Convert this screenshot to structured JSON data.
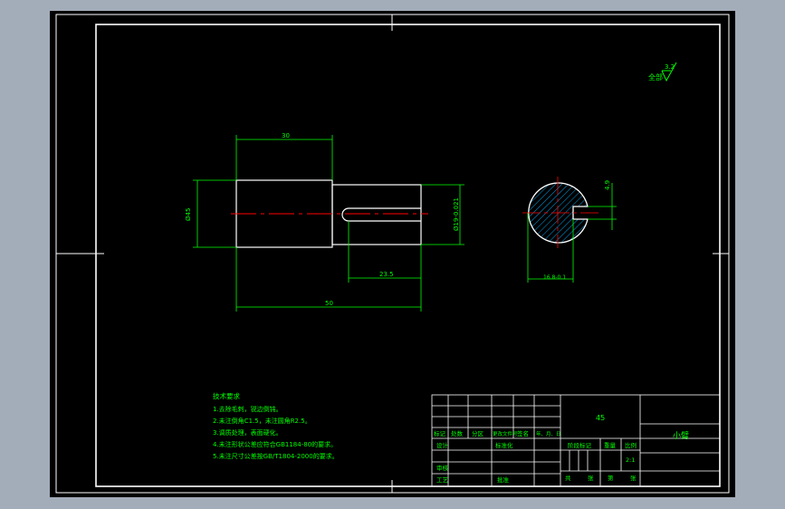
{
  "colors": {
    "background": "#000000",
    "frame": "#ffffff",
    "dimension": "#00ff00",
    "text": "#00ff00",
    "centerline": "#ff0000",
    "hatch": "#00b0ff",
    "window": "#a3acb9"
  },
  "roughness": {
    "prefix": "全部",
    "value": "3.2"
  },
  "dims": {
    "d30": "30",
    "d45": "Ø45",
    "d_shaft": "Ø19-0.021",
    "d23": "23.5",
    "d50": "50",
    "d4": "4.9",
    "d16": "16.8-0.1"
  },
  "notes": {
    "title": "技术要求",
    "lines": [
      "1.去除毛刺，锐边倒钝。",
      "2.未注倒角C1.5，未注圆角R2.5。",
      "3.调质处理，表面硬化。",
      "4.未注形状公差应符合GB1184-80的要求。",
      "5.未注尺寸公差按GB/T1804-2000的要求。"
    ]
  },
  "title_block": {
    "material": "45",
    "part_name": "小臂",
    "header_labels": [
      "标记",
      "处数",
      "分区",
      "更改文件号",
      "签名",
      "年、月、日"
    ],
    "row_design": "设计",
    "row_standard": "标准化",
    "row_check": "审核",
    "row_process": "工艺",
    "row_approve": "批准",
    "stage_mark": "阶段标记",
    "weight": "重量",
    "scale_label": "比例",
    "scale": "2:1",
    "sheets": [
      "共",
      "张",
      "第",
      "张"
    ]
  }
}
